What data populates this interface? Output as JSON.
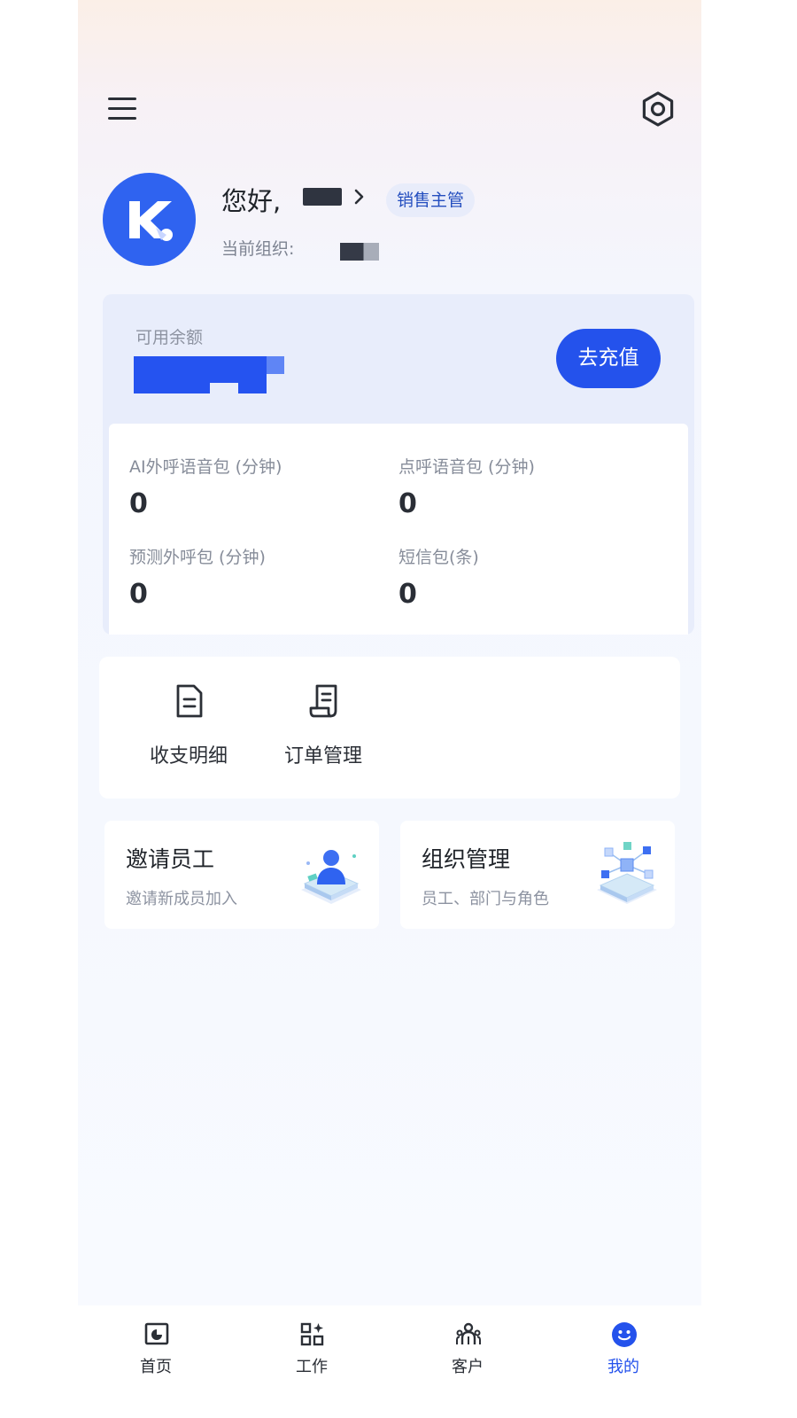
{
  "header": {
    "greeting": "您好,",
    "role_badge": "销售主管",
    "org_label": "当前组织:"
  },
  "balance": {
    "label": "可用余额",
    "recharge_label": "去充值"
  },
  "stats": [
    {
      "label": "AI外呼语音包 (分钟)",
      "value": "0"
    },
    {
      "label": "点呼语音包 (分钟)",
      "value": "0"
    },
    {
      "label": "预测外呼包 (分钟)",
      "value": "0"
    },
    {
      "label": "短信包(条)",
      "value": "0"
    }
  ],
  "quick_actions": [
    {
      "label": "收支明细",
      "icon": "document-icon"
    },
    {
      "label": "订单管理",
      "icon": "receipt-icon"
    }
  ],
  "feature_cards": [
    {
      "title": "邀请员工",
      "subtitle": "邀请新成员加入",
      "icon": "invite-illustration"
    },
    {
      "title": "组织管理",
      "subtitle": "员工、部门与角色",
      "icon": "org-illustration"
    }
  ],
  "tabbar": {
    "items": [
      {
        "label": "首页",
        "icon": "home-chart-icon"
      },
      {
        "label": "工作",
        "icon": "apps-icon"
      },
      {
        "label": "客户",
        "icon": "customers-icon"
      },
      {
        "label": "我的",
        "icon": "smiley-icon"
      }
    ],
    "active_index": 3
  },
  "colors": {
    "accent": "#2452ec",
    "badge_bg": "#e8ecfa",
    "card_bg": "#e8edfb"
  }
}
